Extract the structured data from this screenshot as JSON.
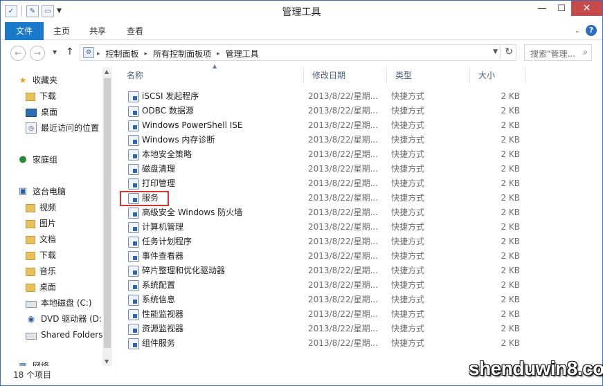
{
  "window": {
    "title": "管理工具",
    "close_glyph": "✕",
    "minimize_glyph": "—",
    "maximize_glyph": "☐"
  },
  "ribbon": {
    "tabs": [
      {
        "label": "文件"
      },
      {
        "label": "主页"
      },
      {
        "label": "共享"
      },
      {
        "label": "查看"
      }
    ],
    "accent": "#1979ca"
  },
  "address": {
    "crumbs": [
      "控制面板",
      "所有控制面板项",
      "管理工具"
    ],
    "search_placeholder": "搜索\"管理..."
  },
  "nav": {
    "items": [
      {
        "label": "收藏夹",
        "icon": "star-icon"
      },
      {
        "label": "下载",
        "icon": "download-folder-icon"
      },
      {
        "label": "桌面",
        "icon": "desktop-icon"
      },
      {
        "label": "最近访问的位置",
        "icon": "recent-places-icon"
      },
      {
        "label": "家庭组",
        "icon": "homegroup-icon"
      },
      {
        "label": "这台电脑",
        "icon": "computer-icon"
      },
      {
        "label": "视频",
        "icon": "folder-icon"
      },
      {
        "label": "图片",
        "icon": "folder-icon"
      },
      {
        "label": "文档",
        "icon": "folder-icon"
      },
      {
        "label": "下载",
        "icon": "download-folder-icon"
      },
      {
        "label": "音乐",
        "icon": "music-folder-icon"
      },
      {
        "label": "桌面",
        "icon": "folder-icon"
      },
      {
        "label": "本地磁盘 (C:)",
        "icon": "drive-icon"
      },
      {
        "label": "DVD 驱动器 (D:)",
        "icon": "dvd-drive-icon"
      },
      {
        "label": "Shared Folders",
        "icon": "shared-folder-icon"
      },
      {
        "label": "网络",
        "icon": "network-icon"
      }
    ]
  },
  "list": {
    "columns": [
      "名称",
      "修改日期",
      "类型",
      "大小"
    ],
    "rows": [
      {
        "name": "iSCSI 发起程序",
        "date": "2013/8/22/星期...",
        "type": "快捷方式",
        "size": "2 KB"
      },
      {
        "name": "ODBC 数据源",
        "date": "2013/8/22/星期...",
        "type": "快捷方式",
        "size": "2 KB"
      },
      {
        "name": "Windows PowerShell ISE",
        "date": "2013/8/22/星期...",
        "type": "快捷方式",
        "size": "2 KB"
      },
      {
        "name": "Windows 内存诊断",
        "date": "2013/8/22/星期...",
        "type": "快捷方式",
        "size": "2 KB"
      },
      {
        "name": "本地安全策略",
        "date": "2013/8/22/星期...",
        "type": "快捷方式",
        "size": "2 KB"
      },
      {
        "name": "磁盘清理",
        "date": "2013/8/22/星期...",
        "type": "快捷方式",
        "size": "2 KB"
      },
      {
        "name": "打印管理",
        "date": "2013/8/22/星期...",
        "type": "快捷方式",
        "size": "2 KB"
      },
      {
        "name": "服务",
        "date": "2013/8/22/星期...",
        "type": "快捷方式",
        "size": "2 KB"
      },
      {
        "name": "高级安全 Windows 防火墙",
        "date": "2013/8/22/星期...",
        "type": "快捷方式",
        "size": "2 KB"
      },
      {
        "name": "计算机管理",
        "date": "2013/8/22/星期...",
        "type": "快捷方式",
        "size": "2 KB"
      },
      {
        "name": "任务计划程序",
        "date": "2013/8/22/星期...",
        "type": "快捷方式",
        "size": "2 KB"
      },
      {
        "name": "事件查看器",
        "date": "2013/8/22/星期...",
        "type": "快捷方式",
        "size": "2 KB"
      },
      {
        "name": "碎片整理和优化驱动器",
        "date": "2013/8/22/星期...",
        "type": "快捷方式",
        "size": "2 KB"
      },
      {
        "name": "系统配置",
        "date": "2013/8/22/星期...",
        "type": "快捷方式",
        "size": "2 KB"
      },
      {
        "name": "系统信息",
        "date": "2013/8/22/星期...",
        "type": "快捷方式",
        "size": "2 KB"
      },
      {
        "name": "性能监视器",
        "date": "2013/8/22/星期...",
        "type": "快捷方式",
        "size": "2 KB"
      },
      {
        "name": "资源监视器",
        "date": "2013/8/22/星期...",
        "type": "快捷方式",
        "size": "2 KB"
      },
      {
        "name": "组件服务",
        "date": "2013/8/22/星期...",
        "type": "快捷方式",
        "size": "2 KB"
      }
    ],
    "highlight_color": "#d33434"
  },
  "status": {
    "count": "18 个项目"
  },
  "watermark": "shenduwin8.com"
}
